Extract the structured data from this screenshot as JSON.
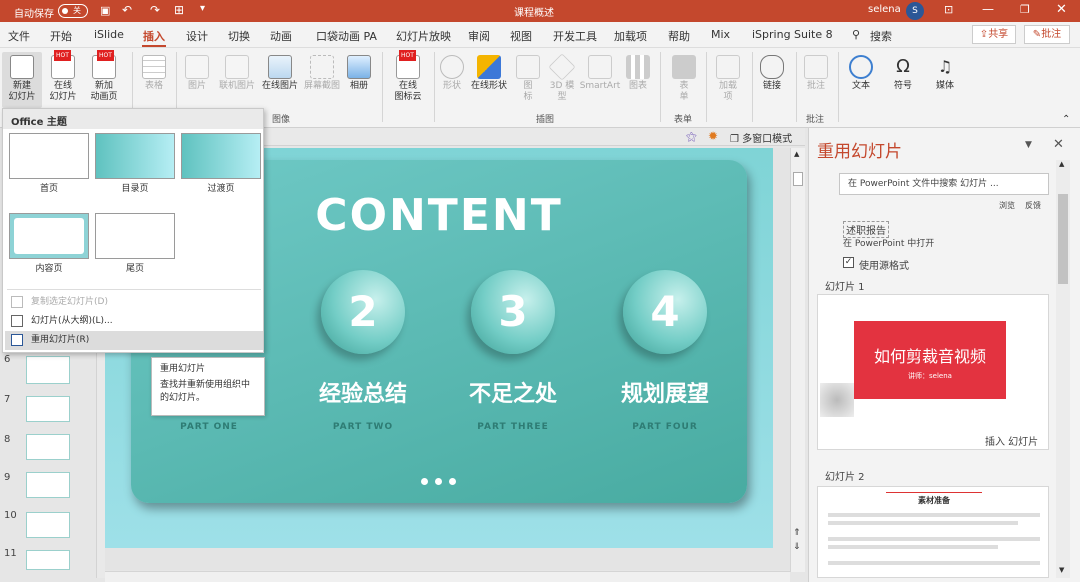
{
  "titlebar": {
    "autosave_label": "自动保存",
    "autosave_state": "关",
    "doc_title": "课程概述",
    "user_name": "selena",
    "user_initial": "S"
  },
  "menu": {
    "items": [
      "文件",
      "开始",
      "iSlide",
      "插入",
      "设计",
      "切换",
      "动画",
      "口袋动画 PA",
      "幻灯片放映",
      "审阅",
      "视图",
      "开发工具",
      "加载项",
      "帮助",
      "Mix",
      "iSpring Suite 8",
      "搜索"
    ],
    "active": "插入",
    "share_label": "共享",
    "comment_label": "批注"
  },
  "ribbon": {
    "new_slide": "新建\n幻灯片",
    "online_slide": "在线\n幻灯片",
    "new_anim_page": "新加\n动画页",
    "table": "表格",
    "picture": "图片",
    "online_picture_lj": "联机图片",
    "online_picture": "在线图片",
    "screenshot": "屏幕截图",
    "album": "相册",
    "online_icon": "在线\n图标云",
    "shapes": "形状",
    "online_shapes": "在线形状",
    "icons": "图\n标",
    "model3d": "3D 模\n型",
    "smartart": "SmartArt",
    "chart": "图表",
    "form": "表\n单",
    "addins": "加载\n项",
    "link": "链接",
    "comment": "批注",
    "text": "文本",
    "symbol": "符号",
    "media": "媒体",
    "group_image": "图像",
    "group_illustrate": "插图",
    "group_form": "表单",
    "group_comment": "批注",
    "hot_badge": "HOT"
  },
  "dropdown": {
    "header": "Office 主题",
    "layouts": [
      "首页",
      "目录页",
      "过渡页",
      "内容页",
      "尾页"
    ],
    "items": [
      "复制选定幻灯片(D)",
      "幻灯片(从大纲)(L)...",
      "重用幻灯片(R)"
    ]
  },
  "tooltip": {
    "title": "重用幻灯片",
    "body": "查找并重新使用组织中的幻灯片。"
  },
  "view_toolbar": {
    "multi_window": "多窗口模式"
  },
  "slide_panel": {
    "numbers": [
      "6",
      "7",
      "8",
      "9",
      "10",
      "11"
    ]
  },
  "slide": {
    "title": "CONTENT",
    "parts": [
      {
        "num": "2",
        "cn": "经验总结",
        "en": "PART TWO"
      },
      {
        "num": "3",
        "cn": "不足之处",
        "en": "PART THREE"
      },
      {
        "num": "4",
        "cn": "规划展望",
        "en": "PART FOUR"
      }
    ],
    "part_one": "PART ONE"
  },
  "reuse_panel": {
    "title": "重用幻灯片",
    "search_placeholder": "在 PowerPoint 文件中搜索 幻灯片 ...",
    "browse": "浏览",
    "feedback": "反馈",
    "file_name": "述职报告",
    "open_in_ppt": "在 PowerPoint 中打开",
    "keep_format": "使用源格式",
    "slide1_label": "幻灯片 1",
    "slide1_title": "如何剪裁音视频",
    "slide1_sub": "讲师：selena",
    "insert_slide": "插入 幻灯片",
    "slide2_label": "幻灯片 2",
    "slide2_title": "素材准备"
  },
  "colors": {
    "accent": "#c4482d",
    "slide_teal": "#48aba1"
  }
}
